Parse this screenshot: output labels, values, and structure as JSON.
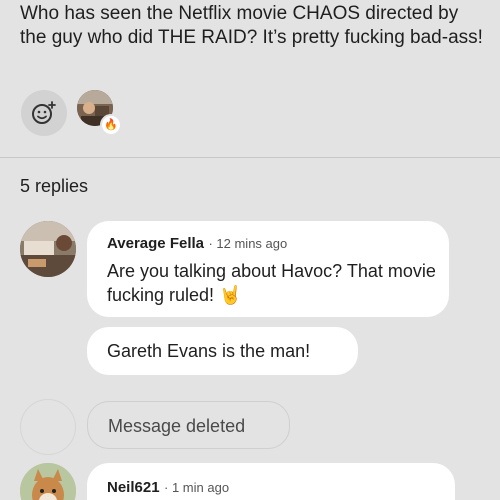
{
  "post": {
    "text": "Who has seen the Netflix movie CHAOS directed by the guy who did THE RAID? It’s pretty fucking bad-ass!",
    "reaction_badge_icon": "fire-icon",
    "reaction_badge_glyph": "🔥"
  },
  "replies": {
    "count_label": "5 replies",
    "items": [
      {
        "author": "Average Fella",
        "time": "12 mins ago",
        "message": "Are you talking about Havoc? That movie fucking ruled! 🤘"
      },
      {
        "message": "Gareth Evans is the man!"
      },
      {
        "message": "Message deleted"
      },
      {
        "author": "Neil621",
        "time": "1 min ago"
      }
    ]
  },
  "colors": {
    "background": "#e3e3e3",
    "bubble": "#ffffff",
    "text": "#1f1f1f",
    "muted": "#555555"
  }
}
